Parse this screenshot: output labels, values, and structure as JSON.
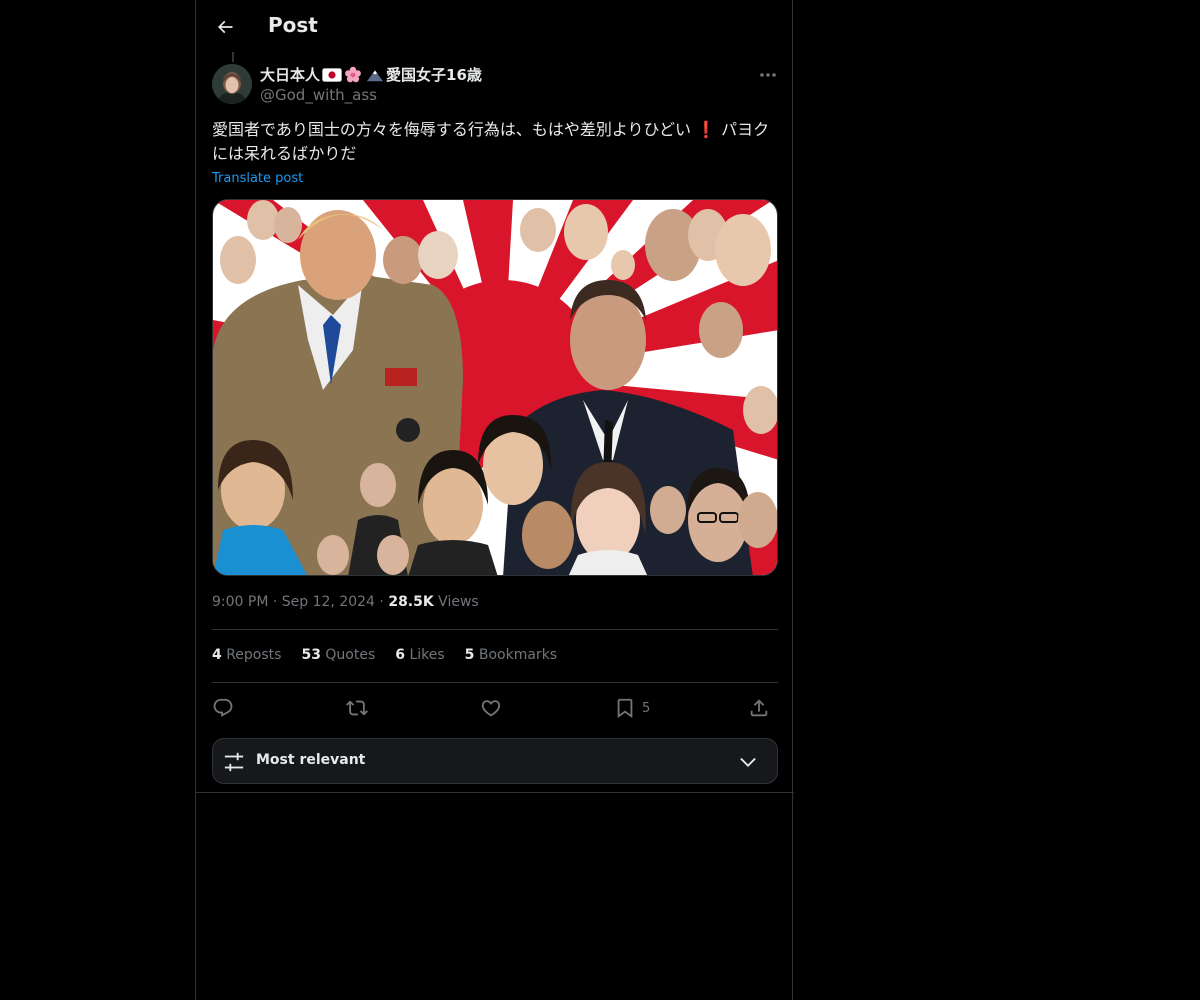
{
  "header": {
    "title": "Post"
  },
  "post": {
    "author": {
      "name": "大日本人",
      "name_suffix": "愛国女子16歳",
      "handle": "@God_with_ass"
    },
    "text_part1": "愛国者であり国士の方々を侮辱する行為は、もはや差別よりひどい",
    "text_excl": "❗",
    "text_part2": " パヨクには呆れるばかりだ",
    "translate_label": "Translate post",
    "time": "9:00 PM",
    "date": "Sep 12, 2024",
    "separator": "·",
    "views_count": "28.5K",
    "views_label": "Views"
  },
  "stats": [
    {
      "count": "4",
      "label": "Reposts"
    },
    {
      "count": "53",
      "label": "Quotes"
    },
    {
      "count": "6",
      "label": "Likes"
    },
    {
      "count": "5",
      "label": "Bookmarks"
    }
  ],
  "actions": {
    "reply_icon": "reply-icon",
    "repost_icon": "repost-icon",
    "like_icon": "heart-icon",
    "bookmark_icon": "bookmark-icon",
    "bookmark_count": "5",
    "share_icon": "share-icon"
  },
  "sort": {
    "label": "Most relevant"
  },
  "colors": {
    "background": "#000000",
    "text": "#e7e9ea",
    "muted": "#71767b",
    "link": "#1d9bf0",
    "border": "#2f3336"
  }
}
